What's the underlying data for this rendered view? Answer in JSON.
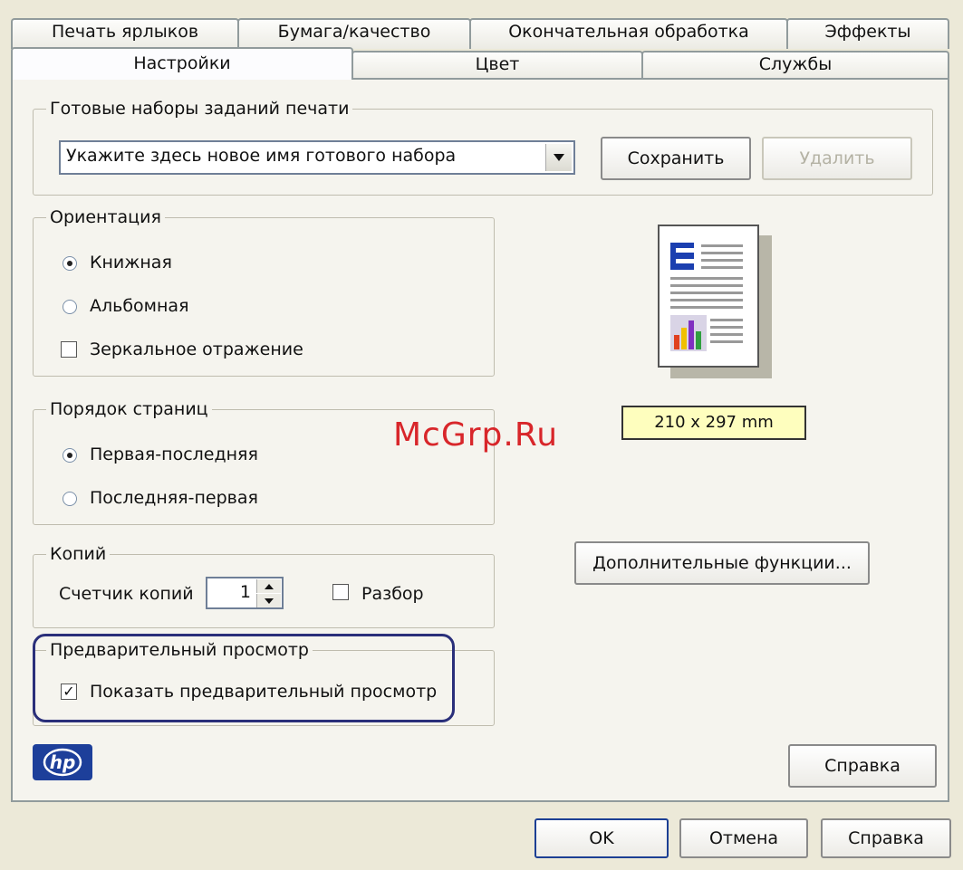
{
  "tabs_row1": [
    "Печать ярлыков",
    "Бумага/качество",
    "Окончательная обработка",
    "Эффекты"
  ],
  "tabs_row2": [
    "Настройки",
    "Цвет",
    "Службы"
  ],
  "presets": {
    "legend": "Готовые наборы заданий печати",
    "dropdown_value": "Укажите здесь новое имя готового набора",
    "save_label": "Сохранить",
    "delete_label": "Удалить"
  },
  "orientation": {
    "legend": "Ориентация",
    "portrait": "Книжная",
    "landscape": "Альбомная",
    "mirror": "Зеркальное отражение",
    "selected": "portrait"
  },
  "page_order": {
    "legend": "Порядок страниц",
    "first_last": "Первая-последняя",
    "last_first": "Последняя-первая",
    "selected": "first_last"
  },
  "copies": {
    "legend": "Копий",
    "counter_label": "Счетчик копий",
    "value": "1",
    "collate": "Разбор"
  },
  "preview": {
    "legend": "Предварительный просмотр",
    "show": "Показать предварительный просмотр",
    "checked": true
  },
  "paper_size": "210 x 297 mm",
  "advanced_label": "Дополнительные функции...",
  "help_inner_label": "Справка",
  "logo_text": "hp",
  "watermark": "McGrp.Ru",
  "bottom": {
    "ok": "OK",
    "cancel": "Отмена",
    "help": "Справка"
  },
  "colors": {
    "accent_circle": "#2a2f7a",
    "watermark": "#d8262a",
    "hp_blue": "#1d3f9a",
    "paper_label_bg": "#fefebe"
  }
}
